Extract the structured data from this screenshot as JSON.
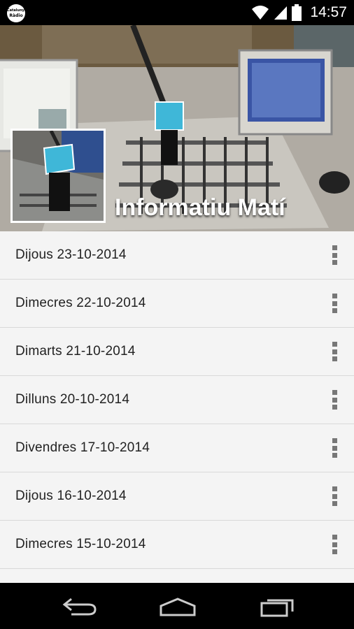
{
  "status_bar": {
    "app_logo_line1": "Catalunya",
    "app_logo_line2": "Ràdio",
    "time": "14:57",
    "icons": [
      "wifi-icon",
      "signal-icon",
      "battery-icon"
    ]
  },
  "header": {
    "title": "Informatiu Matí"
  },
  "episodes": [
    {
      "label": "Dijous 23-10-2014"
    },
    {
      "label": "Dimecres 22-10-2014"
    },
    {
      "label": "Dimarts 21-10-2014"
    },
    {
      "label": "Dilluns 20-10-2014"
    },
    {
      "label": "Divendres 17-10-2014"
    },
    {
      "label": "Dijous 16-10-2014"
    },
    {
      "label": "Dimecres 15-10-2014"
    },
    {
      "label": ""
    }
  ],
  "navigation": {
    "buttons": [
      "back-icon",
      "home-icon",
      "recent-apps-icon"
    ]
  },
  "colors": {
    "list_background": "#f4f4f4",
    "divider": "#d9d9d9",
    "text": "#222222",
    "overflow_icon": "#777777"
  }
}
